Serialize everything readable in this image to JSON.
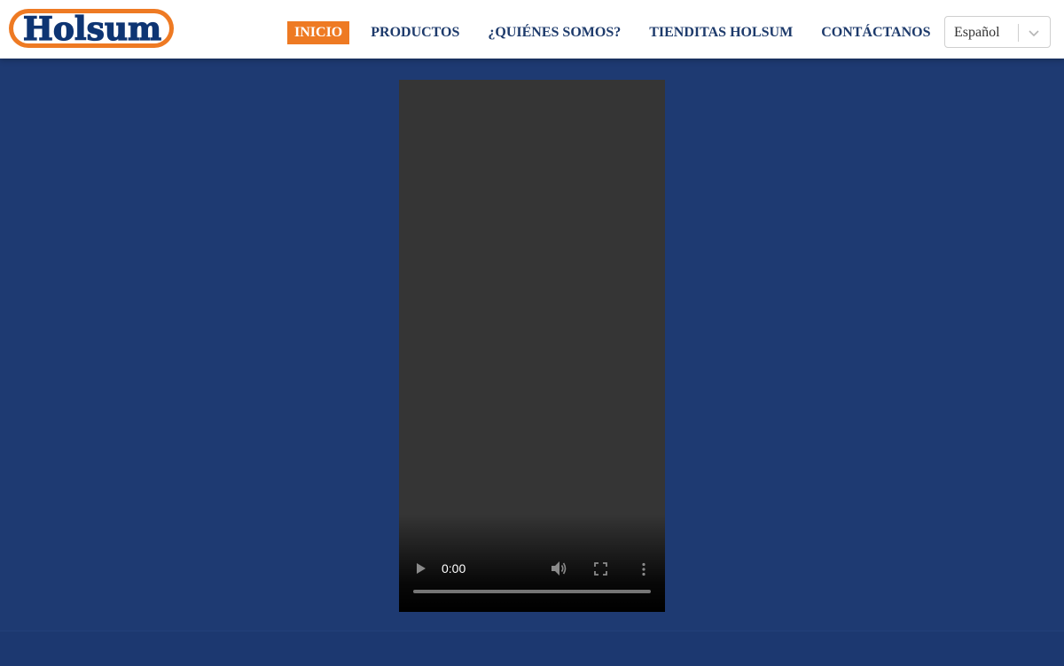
{
  "brand": {
    "logo_text": "Holsum",
    "colors": {
      "primary_blue": "#1d3a6b",
      "accent_orange": "#ee7a23",
      "page_background": "#1e3a72"
    }
  },
  "nav": {
    "items": [
      {
        "label": "INICIO",
        "active": true
      },
      {
        "label": "PRODUCTOS",
        "active": false
      },
      {
        "label": "¿QUIÉNES SOMOS?",
        "active": false
      },
      {
        "label": "TIENDITAS HOLSUM",
        "active": false
      },
      {
        "label": "CONTÁCTANOS",
        "active": false
      }
    ]
  },
  "language": {
    "selected": "Español",
    "chevron_icon": "chevron-down-icon"
  },
  "video": {
    "current_time": "0:00",
    "progress": 0,
    "icons": [
      "play-icon",
      "volume-icon",
      "fullscreen-icon",
      "more-options-icon"
    ]
  }
}
